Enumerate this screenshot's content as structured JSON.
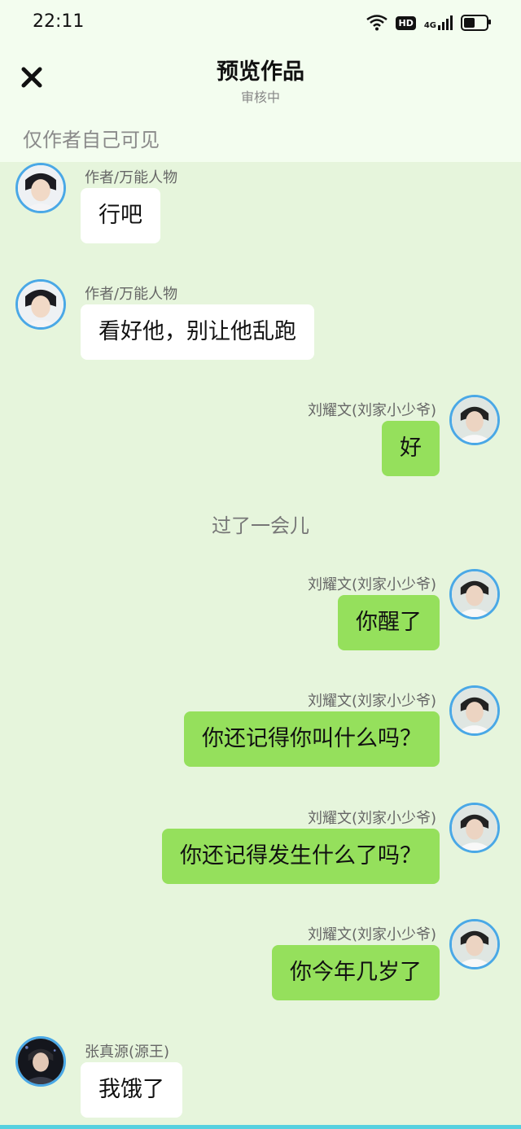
{
  "status": {
    "time": "22:11",
    "hd": "HD",
    "network": "4G",
    "battery_level": 0.5
  },
  "header": {
    "title": "预览作品",
    "subtitle": "审核中",
    "visibility_note": "仅作者自己可见"
  },
  "messages": [
    {
      "sender": "作者/万能人物",
      "side": "left",
      "text": "行吧"
    },
    {
      "sender": "作者/万能人物",
      "side": "left",
      "text": "看好他，别让他乱跑"
    },
    {
      "sender": "刘耀文(刘家小少爷)",
      "side": "right",
      "text": "好"
    },
    {
      "type": "divider",
      "text": "过了一会儿"
    },
    {
      "sender": "刘耀文(刘家小少爷)",
      "side": "right",
      "text": "你醒了"
    },
    {
      "sender": "刘耀文(刘家小少爷)",
      "side": "right",
      "text": "你还记得你叫什么吗？"
    },
    {
      "sender": "刘耀文(刘家小少爷)",
      "side": "right",
      "text": "你还记得发生什么了吗？"
    },
    {
      "sender": "刘耀文(刘家小少爷)",
      "side": "right",
      "text": "你今年几岁了"
    },
    {
      "sender": "张真源(源王)",
      "side": "left",
      "text": "我饿了"
    }
  ],
  "colors": {
    "background": "#e6f5dc",
    "header": "#f3fdef",
    "right_bubble": "#95e05c",
    "left_bubble": "#ffffff",
    "avatar_ring": "#4aa8e6"
  }
}
